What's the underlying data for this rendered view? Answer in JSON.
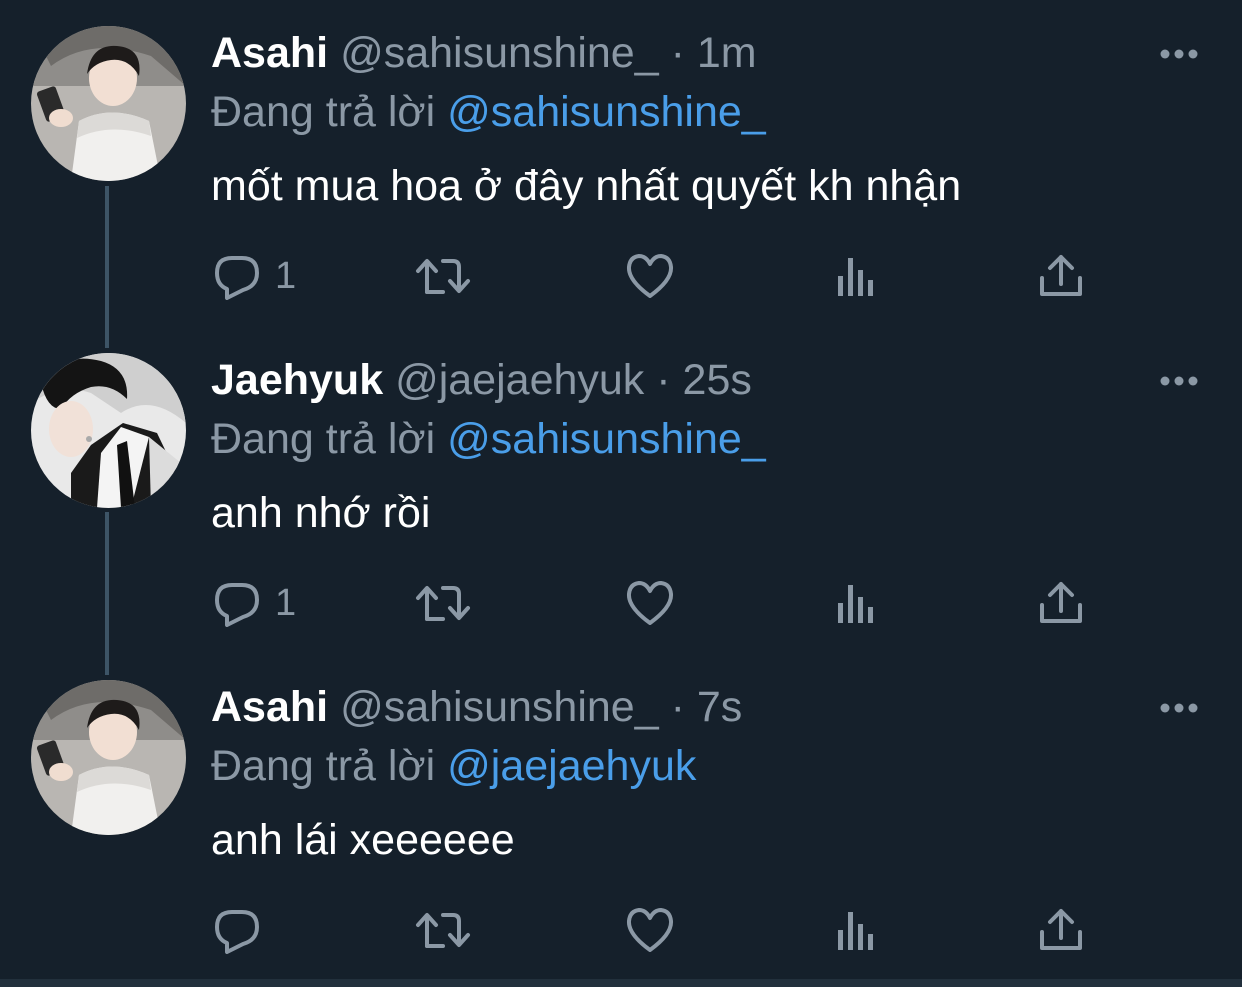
{
  "tweets": [
    {
      "name": "Asahi",
      "handle": "@sahisunshine_",
      "time": "· 1m",
      "replying_label": "Đang trả lời",
      "replying_to": "@sahisunshine_",
      "text": "mốt mua hoa ở đây nhất quyết kh nhận",
      "reply_count": "1",
      "avatar": "asahi-avatar"
    },
    {
      "name": "Jaehyuk",
      "handle": "@jaejaehyuk",
      "time": "· 25s",
      "replying_label": "Đang trả lời",
      "replying_to": "@sahisunshine_",
      "text": "anh nhớ rồi",
      "reply_count": "1",
      "avatar": "jaehyuk-avatar"
    },
    {
      "name": "Asahi",
      "handle": "@sahisunshine_",
      "time": "· 7s",
      "replying_label": "Đang trả lời",
      "replying_to": "@jaejaehyuk",
      "text": "anh lái xeeeeee",
      "reply_count": "",
      "avatar": "asahi-avatar"
    }
  ],
  "icons": {
    "reply": "reply-icon",
    "retweet": "retweet-icon",
    "like": "like-icon",
    "views": "views-icon",
    "share": "share-icon",
    "more": "more-icon"
  },
  "colors": {
    "background": "#15202b",
    "name": "#ffffff",
    "secondary": "#8b98a5",
    "mention": "#4a9ee9",
    "thread_line": "#3d5466"
  }
}
